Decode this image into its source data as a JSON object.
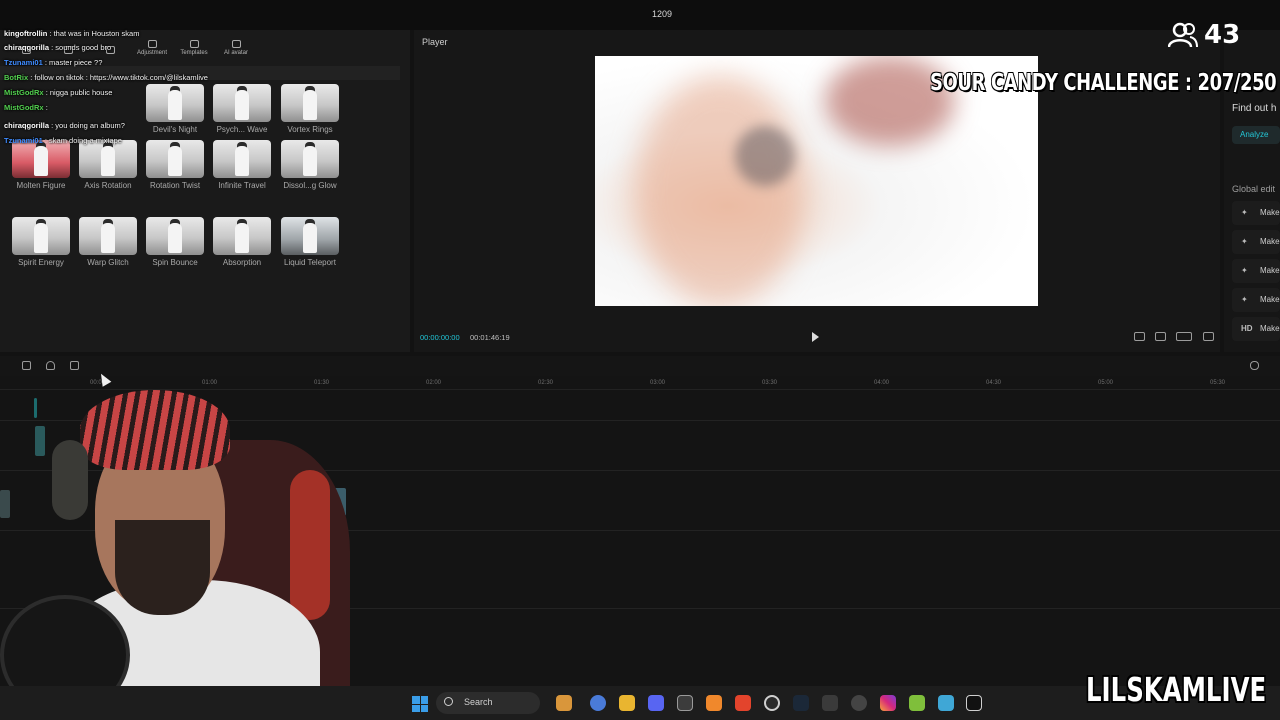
{
  "app": {
    "project_title": "1209",
    "player_label": "Player"
  },
  "media_tabs": [
    {
      "label": "",
      "icon": "import-icon"
    },
    {
      "label": "",
      "icon": "audio-icon"
    },
    {
      "label": "",
      "icon": "text-icon"
    },
    {
      "label": "Adjustment",
      "icon": "adjustment-icon"
    },
    {
      "label": "Templates",
      "icon": "templates-icon"
    },
    {
      "label": "AI avatar",
      "icon": "ai-avatar-icon"
    }
  ],
  "effects": [
    {
      "label": "Devil's Night",
      "style": "normal"
    },
    {
      "label": "Psych... Wave",
      "style": "normal"
    },
    {
      "label": "Vortex Rings",
      "style": "normal"
    },
    {
      "label": "Molten Figure",
      "style": "red"
    },
    {
      "label": "Axis Rotation",
      "style": "normal"
    },
    {
      "label": "Rotation Twist",
      "style": "normal"
    },
    {
      "label": "Infinite Travel",
      "style": "normal"
    },
    {
      "label": "Dissol...g Glow",
      "style": "normal"
    },
    {
      "label": "Spirit Energy",
      "style": "normal"
    },
    {
      "label": "Warp Glitch",
      "style": "normal"
    },
    {
      "label": "Spin Bounce",
      "style": "normal"
    },
    {
      "label": "Absorption",
      "style": "normal"
    },
    {
      "label": "Liquid Teleport",
      "style": "silver"
    }
  ],
  "chat": [
    {
      "user": "kingoftrollin",
      "msg": ": that was in Houston skam",
      "color": "#ffffff"
    },
    {
      "user": "chiraqgorilla",
      "msg": ": sounds good bro",
      "color": "#ffffff"
    },
    {
      "user": "Tzunami01",
      "msg": ": master piece ??",
      "color": "#3f8cff"
    },
    {
      "user": "BotRix",
      "msg": ": follow on tiktok : https://www.tiktok.com/@lilskamlive",
      "color": "#52d04f"
    },
    {
      "user": "MistGodRx",
      "msg": ": nigga public house",
      "color": "#52d04f"
    },
    {
      "user": "MistGodRx",
      "msg": ":",
      "color": "#52d04f"
    },
    {
      "user": "chiraqgorilla",
      "msg": ": you doing an album?",
      "color": "#ffffff"
    },
    {
      "user": "Tzunami01",
      "msg": ": skam doing a mixtape",
      "color": "#3f8cff"
    }
  ],
  "player": {
    "time_current": "00:00:00:00",
    "time_total": "00:01:46:19"
  },
  "right_panel": {
    "findout": "Find out h",
    "analyze": "Analyze",
    "global": "Global edit",
    "items": [
      {
        "label": "Make",
        "icon": "magic-wand-icon"
      },
      {
        "label": "Make",
        "icon": "color-icon"
      },
      {
        "label": "Make",
        "icon": "sliders-icon"
      },
      {
        "label": "Make",
        "icon": "audio-wave-icon"
      },
      {
        "label": "Make",
        "icon": "hd-icon",
        "glyph": "HD"
      }
    ]
  },
  "overlay": {
    "challenge": "SOUR CANDY CHALLENGE : 207/250",
    "viewers": "43",
    "channel": "LILSKAMLIVE"
  },
  "timeline": {
    "ticks": [
      "00:00",
      "01:00",
      "01:30",
      "02:00",
      "02:30",
      "03:00",
      "03:30",
      "04:00",
      "04:30",
      "05:00",
      "05:30"
    ]
  },
  "taskbar": {
    "search_label": "Search"
  }
}
